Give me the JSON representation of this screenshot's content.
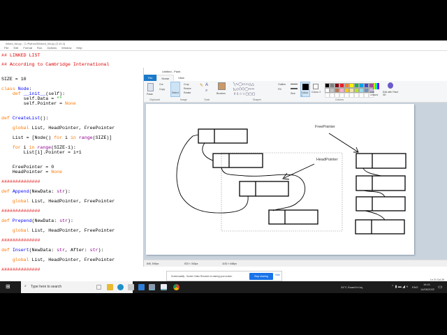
{
  "idle": {
    "title": "linked_list.py - C:/Python3/linked_list.py (3.10.4)",
    "menu": [
      "File",
      "Edit",
      "Format",
      "Run",
      "Options",
      "Window",
      "Help"
    ],
    "status": "Ln 21  Col 29",
    "lines": [
      {
        "row": 79,
        "tokens": [
          [
            "## LINKED LIST",
            "comment"
          ]
        ]
      },
      {
        "row": 92,
        "tokens": [
          [
            "## According to Cambridge International",
            "comment"
          ]
        ]
      },
      {
        "row": 113,
        "tokens": [
          [
            "SIZE = 10",
            ""
          ]
        ]
      },
      {
        "row": 127,
        "tokens": [
          [
            "class",
            "kw"
          ],
          [
            " ",
            ""
          ],
          [
            "Node",
            "def"
          ],
          [
            ":",
            ""
          ]
        ]
      },
      {
        "row": 134,
        "tokens": [
          [
            "    ",
            ""
          ],
          [
            "def",
            "kw"
          ],
          [
            " ",
            ""
          ],
          [
            "__init__",
            "def"
          ],
          [
            "(self):",
            ""
          ]
        ]
      },
      {
        "row": 141,
        "tokens": [
          [
            "        self.Data = ",
            ""
          ],
          [
            "\"\"",
            "str"
          ]
        ]
      },
      {
        "row": 148,
        "tokens": [
          [
            "        self.Pointer = ",
            ""
          ],
          [
            "None",
            "kw"
          ]
        ]
      },
      {
        "row": 169,
        "tokens": [
          [
            "def",
            "kw"
          ],
          [
            " ",
            ""
          ],
          [
            "CreateList",
            "def"
          ],
          [
            "():",
            ""
          ]
        ]
      },
      {
        "row": 183,
        "tokens": [
          [
            "    ",
            ""
          ],
          [
            "global",
            "kw"
          ],
          [
            " List, HeadPointer, FreePointer",
            ""
          ]
        ]
      },
      {
        "row": 197,
        "tokens": [
          [
            "    List = [Node() ",
            ""
          ],
          [
            "for",
            "kw"
          ],
          [
            " i ",
            ""
          ],
          [
            "in",
            "kw"
          ],
          [
            " ",
            ""
          ],
          [
            "range",
            "bi"
          ],
          [
            "(SIZE)]",
            ""
          ]
        ]
      },
      {
        "row": 211,
        "tokens": [
          [
            "    ",
            ""
          ],
          [
            "for",
            "kw"
          ],
          [
            " i ",
            ""
          ],
          [
            "in",
            "kw"
          ],
          [
            " ",
            ""
          ],
          [
            "range",
            "bi"
          ],
          [
            "(SIZE-1):",
            ""
          ]
        ]
      },
      {
        "row": 218,
        "tokens": [
          [
            "        List[i].Pointer = i+1",
            ""
          ]
        ]
      },
      {
        "row": 239,
        "tokens": [
          [
            "    FreePointer = 0",
            ""
          ]
        ]
      },
      {
        "row": 246,
        "tokens": [
          [
            "    HeadPointer = ",
            ""
          ],
          [
            "None",
            "kw"
          ]
        ]
      },
      {
        "row": 260,
        "tokens": [
          [
            "##############",
            "comment"
          ]
        ]
      },
      {
        "row": 274,
        "tokens": [
          [
            "def",
            "kw"
          ],
          [
            " ",
            ""
          ],
          [
            "Append",
            "def"
          ],
          [
            "(NewData: ",
            ""
          ],
          [
            "str",
            "bi"
          ],
          [
            "):",
            ""
          ]
        ]
      },
      {
        "row": 288,
        "tokens": [
          [
            "    ",
            ""
          ],
          [
            "global",
            "kw"
          ],
          [
            " List, HeadPointer, FreePointer",
            ""
          ]
        ]
      },
      {
        "row": 302,
        "tokens": [
          [
            "##############",
            "comment"
          ]
        ]
      },
      {
        "row": 316,
        "tokens": [
          [
            "def",
            "kw"
          ],
          [
            " ",
            ""
          ],
          [
            "Prepend",
            "def"
          ],
          [
            "(NewData: ",
            ""
          ],
          [
            "str",
            "bi"
          ],
          [
            "):",
            ""
          ]
        ]
      },
      {
        "row": 330,
        "tokens": [
          [
            "    ",
            ""
          ],
          [
            "global",
            "kw"
          ],
          [
            " List, HeadPointer, FreePointer",
            ""
          ]
        ]
      },
      {
        "row": 344,
        "tokens": [
          [
            "##############",
            "comment"
          ]
        ]
      },
      {
        "row": 358,
        "tokens": [
          [
            "def",
            "kw"
          ],
          [
            " ",
            ""
          ],
          [
            "Insert",
            "def"
          ],
          [
            "(NewData: ",
            ""
          ],
          [
            "str",
            "bi"
          ],
          [
            ", After: ",
            ""
          ],
          [
            "str",
            "bi"
          ],
          [
            "):",
            ""
          ]
        ]
      },
      {
        "row": 372,
        "tokens": [
          [
            "    ",
            ""
          ],
          [
            "global",
            "kw"
          ],
          [
            " List, HeadPointer, FreePointer",
            ""
          ]
        ]
      },
      {
        "row": 386,
        "tokens": [
          [
            "##############",
            "comment"
          ]
        ]
      }
    ]
  },
  "paint": {
    "title": "Untitled - Paint",
    "tabs": [
      "File",
      "Home",
      "View"
    ],
    "groups": {
      "clipboard": "Clipboard",
      "image": "Image",
      "tools": "Tools",
      "shapes": "Shapes",
      "colours": "Colours"
    },
    "buttons": {
      "paste": "Paste",
      "cut": "Cut",
      "copy": "Copy",
      "select": "Select",
      "crop": "Crop",
      "resize": "Resize",
      "rotate": "Rotate",
      "brushes": "Brushes",
      "outline": "Outline",
      "fill": "Fill",
      "size": "Size",
      "colour1": "Colour 1",
      "colour2": "Colour 2",
      "edit_colours": "Edit colours",
      "edit_paint3d": "Edit with Paint 3D"
    },
    "palette": [
      "#000000",
      "#7f7f7f",
      "#880015",
      "#ed1c24",
      "#ff7f27",
      "#fff200",
      "#22b14c",
      "#00a2e8",
      "#3f48cc",
      "#a349a4",
      "#ffffff",
      "#c3c3c3",
      "#b97a57",
      "#ffaec9",
      "#ffc90e",
      "#efe4b0",
      "#b5e61d",
      "#99d9ea",
      "#7092be",
      "#c8bfe7"
    ],
    "status": {
      "cursor": "845, 549px",
      "selection": "523 × 343px",
      "canvas_size": "1152 × 648px"
    },
    "drawing": {
      "free_label": "FreePointer",
      "head_label": "HeadPointer"
    }
  },
  "banner": {
    "text": "Screencastify - Screen Video Recorder is sharing your screen.",
    "stop": "Stop sharing",
    "hide": "Hide"
  },
  "taskbar": {
    "search_placeholder": "Type here to search",
    "weather": "34°C  Ánamlʼmʼaŋ",
    "lang": "ENG",
    "time": "16:41",
    "date": "14/05/2022"
  }
}
